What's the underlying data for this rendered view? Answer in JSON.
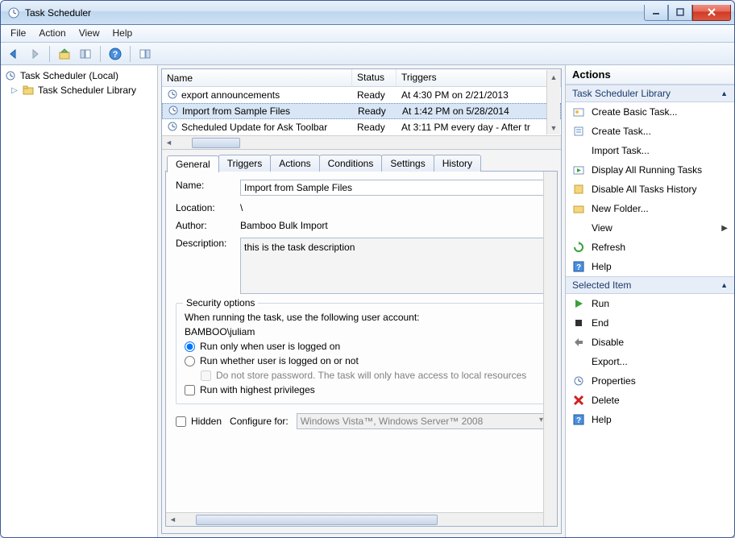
{
  "window": {
    "title": "Task Scheduler"
  },
  "menu": {
    "file": "File",
    "action": "Action",
    "view": "View",
    "help": "Help"
  },
  "tree": {
    "root": "Task Scheduler (Local)",
    "library": "Task Scheduler Library"
  },
  "tasklist": {
    "headers": {
      "name": "Name",
      "status": "Status",
      "triggers": "Triggers"
    },
    "rows": [
      {
        "name": "export announcements",
        "status": "Ready",
        "triggers": "At 4:30 PM on 2/21/2013"
      },
      {
        "name": "Import from Sample Files",
        "status": "Ready",
        "triggers": "At 1:42 PM on 5/28/2014"
      },
      {
        "name": "Scheduled Update for Ask Toolbar",
        "status": "Ready",
        "triggers": "At 3:11 PM every day - After tr"
      }
    ]
  },
  "tabs": {
    "general": "General",
    "triggers": "Triggers",
    "actions": "Actions",
    "conditions": "Conditions",
    "settings": "Settings",
    "history": "History"
  },
  "general": {
    "name_label": "Name:",
    "name_value": "Import from Sample Files",
    "location_label": "Location:",
    "location_value": "\\",
    "author_label": "Author:",
    "author_value": "Bamboo Bulk Import",
    "description_label": "Description:",
    "description_value": "this is the task description",
    "security_legend": "Security options",
    "security_text": "When running the task, use the following user account:",
    "security_account": "BAMBOO\\juliam",
    "radio_logged_on": "Run only when user is logged on",
    "radio_logged_off": "Run whether user is logged on or not",
    "no_store_pw": "Do not store password.  The task will only have access to local resources",
    "highest_priv": "Run with highest privileges",
    "hidden_label": "Hidden",
    "configure_label": "Configure for:",
    "configure_value": "Windows Vista™, Windows Server™ 2008"
  },
  "actions": {
    "title": "Actions",
    "group1": "Task Scheduler Library",
    "create_basic": "Create Basic Task...",
    "create_task": "Create Task...",
    "import_task": "Import Task...",
    "display_running": "Display All Running Tasks",
    "disable_history": "Disable All Tasks History",
    "new_folder": "New Folder...",
    "view": "View",
    "refresh": "Refresh",
    "help": "Help",
    "group2": "Selected Item",
    "run": "Run",
    "end": "End",
    "disable": "Disable",
    "export": "Export...",
    "properties": "Properties",
    "delete": "Delete"
  }
}
